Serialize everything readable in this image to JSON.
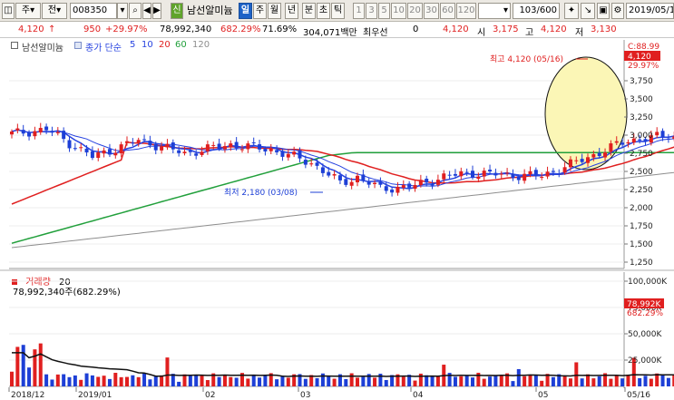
{
  "toolbar": {
    "menu_box": "주",
    "full_box": "전",
    "stock_code": "008350",
    "credit_badge": "신",
    "stock_name": "남선알미늄",
    "periods": [
      {
        "label": "일",
        "active": true
      },
      {
        "label": "주",
        "active": false
      },
      {
        "label": "월",
        "active": false
      },
      {
        "label": "년",
        "active": false
      },
      {
        "label": "분",
        "active": false
      },
      {
        "label": "초",
        "active": false
      },
      {
        "label": "틱",
        "active": false
      }
    ],
    "intervals": [
      "1",
      "3",
      "5",
      "10",
      "20",
      "30",
      "60",
      "120"
    ],
    "count_display": "103",
    "count_total": "/600",
    "date": "2019/05/1",
    "buy_button": "매수"
  },
  "quote": {
    "price": "4,120",
    "change": "950",
    "change_pct": "+29.97%",
    "volume": "78,992,340",
    "volume_ratio": "682.29%",
    "turnover": "71.69%",
    "trade_value": "304,071백만",
    "lowest_label": "최우선",
    "lowest_value": "0",
    "ask": "4,120",
    "open_label": "시",
    "open": "3,175",
    "high_label": "고",
    "high": "4,120",
    "low_label": "저",
    "low": "3,130"
  },
  "legend": {
    "name": "남선알미늄",
    "ma_label": "종가 단순",
    "ma5": "5",
    "ma10": "10",
    "ma20": "20",
    "ma60": "60",
    "ma120": "120"
  },
  "annotations": {
    "high_note": "최고 4,120 (05/16)",
    "low_note": "최저 2,180 (03/08)"
  },
  "price_axis": {
    "ticks": [
      "3,750",
      "3,500",
      "3,250",
      "3,000",
      "2,750",
      "2,500",
      "2,250",
      "2,000",
      "1,750",
      "1,500",
      "1,250"
    ],
    "top_label": "C:88.99",
    "current_tag": "4,120",
    "current_pct": "29.97%"
  },
  "volume": {
    "legend_title": "거래량",
    "legend_period": "20",
    "sub_label": "78,992,340주(682.29%)",
    "ticks": [
      "100,000K",
      "75,000K",
      "50,000K",
      "25,000K"
    ],
    "current_tag": "78,992K",
    "current_pct": "682.29%"
  },
  "x_axis": {
    "labels": [
      "2018/12",
      "2019/01",
      "02",
      "03",
      "04",
      "05",
      "05/16"
    ]
  },
  "colors": {
    "up": "#e01f1f",
    "down": "#1d3fd6",
    "ma5": "#2743e0",
    "ma20": "#e01f1f",
    "ma60": "#22a03c",
    "ma120": "#8e8e8e",
    "highlight": "#fbf6b6"
  }
}
